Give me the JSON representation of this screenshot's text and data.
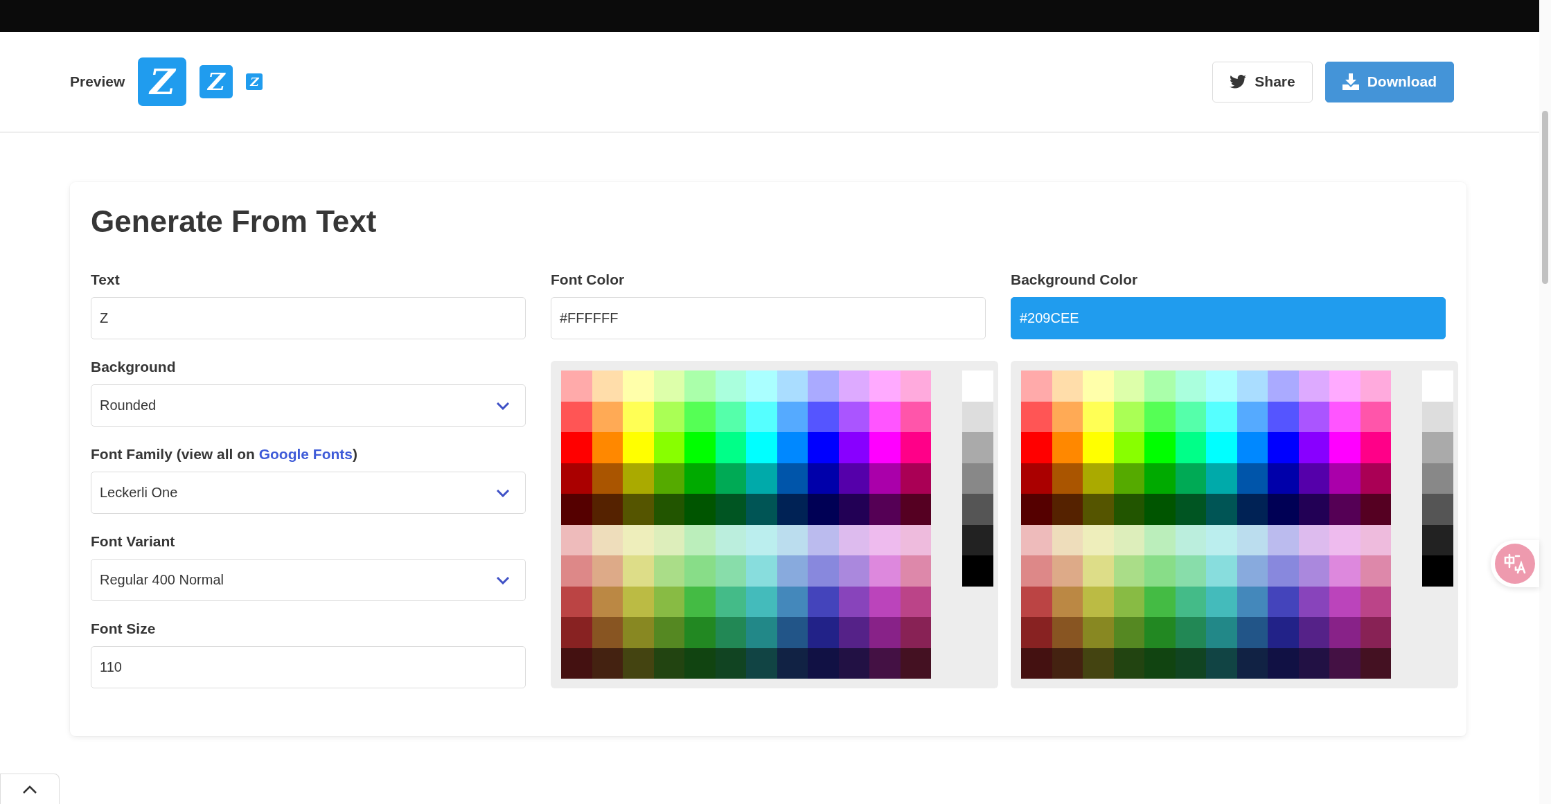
{
  "header": {
    "preview_label": "Preview",
    "preview_icons": [
      {
        "text": "Z"
      },
      {
        "text": "Z"
      },
      {
        "text": "Z"
      }
    ],
    "buttons": [
      {
        "kind": "share",
        "label": "Share"
      },
      {
        "kind": "download",
        "label": "Download"
      }
    ]
  },
  "card": {
    "title": "Generate From Text",
    "fields": [
      {
        "kind": "input",
        "label": "Text",
        "value": "Z"
      },
      {
        "kind": "select",
        "label": "Background",
        "value": "Rounded"
      },
      {
        "kind": "select",
        "label": "Font Family (view all on ",
        "link": "Google Fonts",
        "label_after": ")",
        "value": "Leckerli One"
      },
      {
        "kind": "select",
        "label": "Font Variant",
        "value": "Regular 400 Normal"
      },
      {
        "kind": "input",
        "label": "Font Size",
        "value": "110"
      }
    ],
    "color_pickers": [
      {
        "label": "Font Color",
        "value": "#FFFFFF",
        "swatch_rows": [
          [
            {
              "color": "#ffaaaa"
            },
            {
              "color": "#ffddaa"
            },
            {
              "color": "#ffffaa"
            },
            {
              "color": "#ddffaa"
            },
            {
              "color": "#aaffaa"
            },
            {
              "color": "#aaffdd"
            },
            {
              "color": "#aaffff"
            },
            {
              "color": "#aaddff"
            },
            {
              "color": "#aaaaff"
            },
            {
              "color": "#ddaaff"
            },
            {
              "color": "#ffaaff"
            },
            {
              "color": "#ffaadd"
            }
          ],
          [
            {
              "color": "#ff5555"
            },
            {
              "color": "#ffaa55"
            },
            {
              "color": "#ffff55"
            },
            {
              "color": "#aaff55"
            },
            {
              "color": "#55ff55"
            },
            {
              "color": "#55ffaa"
            },
            {
              "color": "#55ffff"
            },
            {
              "color": "#55aaff"
            },
            {
              "color": "#5555ff"
            },
            {
              "color": "#aa55ff"
            },
            {
              "color": "#ff55ff"
            },
            {
              "color": "#ff55aa"
            }
          ],
          [
            {
              "color": "#ff0000"
            },
            {
              "color": "#ff8800"
            },
            {
              "color": "#ffff00"
            },
            {
              "color": "#88ff00"
            },
            {
              "color": "#00ff00"
            },
            {
              "color": "#00ff88"
            },
            {
              "color": "#00ffff"
            },
            {
              "color": "#0088ff"
            },
            {
              "color": "#0000ff"
            },
            {
              "color": "#8800ff"
            },
            {
              "color": "#ff00ff"
            },
            {
              "color": "#ff0088"
            }
          ],
          [
            {
              "color": "#aa0000"
            },
            {
              "color": "#aa5500"
            },
            {
              "color": "#aaaa00"
            },
            {
              "color": "#55aa00"
            },
            {
              "color": "#00aa00"
            },
            {
              "color": "#00aa55"
            },
            {
              "color": "#00aaaa"
            },
            {
              "color": "#0055aa"
            },
            {
              "color": "#0000aa"
            },
            {
              "color": "#5500aa"
            },
            {
              "color": "#aa00aa"
            },
            {
              "color": "#aa0055"
            }
          ],
          [
            {
              "color": "#550000"
            },
            {
              "color": "#552200"
            },
            {
              "color": "#555500"
            },
            {
              "color": "#225500"
            },
            {
              "color": "#005500"
            },
            {
              "color": "#005522"
            },
            {
              "color": "#005555"
            },
            {
              "color": "#002255"
            },
            {
              "color": "#000055"
            },
            {
              "color": "#220055"
            },
            {
              "color": "#550055"
            },
            {
              "color": "#550022"
            }
          ],
          [
            {
              "color": "#eebbbb"
            },
            {
              "color": "#eeddbb"
            },
            {
              "color": "#eeeebb"
            },
            {
              "color": "#ddeebb"
            },
            {
              "color": "#bbeebb"
            },
            {
              "color": "#bbeedd"
            },
            {
              "color": "#bbeeee"
            },
            {
              "color": "#bbddee"
            },
            {
              "color": "#bbbbee"
            },
            {
              "color": "#ddbbee"
            },
            {
              "color": "#eebbee"
            },
            {
              "color": "#eebbdd"
            }
          ],
          [
            {
              "color": "#dd8888"
            },
            {
              "color": "#ddaa88"
            },
            {
              "color": "#dddd88"
            },
            {
              "color": "#aadd88"
            },
            {
              "color": "#88dd88"
            },
            {
              "color": "#88ddaa"
            },
            {
              "color": "#88dddd"
            },
            {
              "color": "#88aadd"
            },
            {
              "color": "#8888dd"
            },
            {
              "color": "#aa88dd"
            },
            {
              "color": "#dd88dd"
            },
            {
              "color": "#dd88aa"
            }
          ],
          [
            {
              "color": "#bb4444"
            },
            {
              "color": "#bb8844"
            },
            {
              "color": "#bbbb44"
            },
            {
              "color": "#88bb44"
            },
            {
              "color": "#44bb44"
            },
            {
              "color": "#44bb88"
            },
            {
              "color": "#44bbbb"
            },
            {
              "color": "#4488bb"
            },
            {
              "color": "#4444bb"
            },
            {
              "color": "#8844bb"
            },
            {
              "color": "#bb44bb"
            },
            {
              "color": "#bb4488"
            }
          ],
          [
            {
              "color": "#882222"
            },
            {
              "color": "#885522"
            },
            {
              "color": "#888822"
            },
            {
              "color": "#558822"
            },
            {
              "color": "#228822"
            },
            {
              "color": "#228855"
            },
            {
              "color": "#228888"
            },
            {
              "color": "#225588"
            },
            {
              "color": "#222288"
            },
            {
              "color": "#552288"
            },
            {
              "color": "#882288"
            },
            {
              "color": "#882255"
            }
          ],
          [
            {
              "color": "#441111"
            },
            {
              "color": "#442211"
            },
            {
              "color": "#444411"
            },
            {
              "color": "#224411"
            },
            {
              "color": "#114411"
            },
            {
              "color": "#114422"
            },
            {
              "color": "#114444"
            },
            {
              "color": "#112244"
            },
            {
              "color": "#111144"
            },
            {
              "color": "#221144"
            },
            {
              "color": "#441144"
            },
            {
              "color": "#441122"
            }
          ]
        ],
        "shade_swatches": [
          {
            "color": "#ffffff"
          },
          {
            "color": "#dddddd"
          },
          {
            "color": "#aaaaaa"
          },
          {
            "color": "#888888"
          },
          {
            "color": "#555555"
          },
          {
            "color": "#222222"
          },
          {
            "color": "#000000"
          }
        ]
      },
      {
        "label": "Background Color",
        "value": "#209CEE",
        "swatch_rows": [
          [
            {
              "color": "#ffaaaa"
            },
            {
              "color": "#ffddaa"
            },
            {
              "color": "#ffffaa"
            },
            {
              "color": "#ddffaa"
            },
            {
              "color": "#aaffaa"
            },
            {
              "color": "#aaffdd"
            },
            {
              "color": "#aaffff"
            },
            {
              "color": "#aaddff"
            },
            {
              "color": "#aaaaff"
            },
            {
              "color": "#ddaaff"
            },
            {
              "color": "#ffaaff"
            },
            {
              "color": "#ffaadd"
            }
          ],
          [
            {
              "color": "#ff5555"
            },
            {
              "color": "#ffaa55"
            },
            {
              "color": "#ffff55"
            },
            {
              "color": "#aaff55"
            },
            {
              "color": "#55ff55"
            },
            {
              "color": "#55ffaa"
            },
            {
              "color": "#55ffff"
            },
            {
              "color": "#55aaff"
            },
            {
              "color": "#5555ff"
            },
            {
              "color": "#aa55ff"
            },
            {
              "color": "#ff55ff"
            },
            {
              "color": "#ff55aa"
            }
          ],
          [
            {
              "color": "#ff0000"
            },
            {
              "color": "#ff8800"
            },
            {
              "color": "#ffff00"
            },
            {
              "color": "#88ff00"
            },
            {
              "color": "#00ff00"
            },
            {
              "color": "#00ff88"
            },
            {
              "color": "#00ffff"
            },
            {
              "color": "#0088ff"
            },
            {
              "color": "#0000ff"
            },
            {
              "color": "#8800ff"
            },
            {
              "color": "#ff00ff"
            },
            {
              "color": "#ff0088"
            }
          ],
          [
            {
              "color": "#aa0000"
            },
            {
              "color": "#aa5500"
            },
            {
              "color": "#aaaa00"
            },
            {
              "color": "#55aa00"
            },
            {
              "color": "#00aa00"
            },
            {
              "color": "#00aa55"
            },
            {
              "color": "#00aaaa"
            },
            {
              "color": "#0055aa"
            },
            {
              "color": "#0000aa"
            },
            {
              "color": "#5500aa"
            },
            {
              "color": "#aa00aa"
            },
            {
              "color": "#aa0055"
            }
          ],
          [
            {
              "color": "#550000"
            },
            {
              "color": "#552200"
            },
            {
              "color": "#555500"
            },
            {
              "color": "#225500"
            },
            {
              "color": "#005500"
            },
            {
              "color": "#005522"
            },
            {
              "color": "#005555"
            },
            {
              "color": "#002255"
            },
            {
              "color": "#000055"
            },
            {
              "color": "#220055"
            },
            {
              "color": "#550055"
            },
            {
              "color": "#550022"
            }
          ],
          [
            {
              "color": "#eebbbb"
            },
            {
              "color": "#eeddbb"
            },
            {
              "color": "#eeeebb"
            },
            {
              "color": "#ddeebb"
            },
            {
              "color": "#bbeebb"
            },
            {
              "color": "#bbeedd"
            },
            {
              "color": "#bbeeee"
            },
            {
              "color": "#bbddee"
            },
            {
              "color": "#bbbbee"
            },
            {
              "color": "#ddbbee"
            },
            {
              "color": "#eebbee"
            },
            {
              "color": "#eebbdd"
            }
          ],
          [
            {
              "color": "#dd8888"
            },
            {
              "color": "#ddaa88"
            },
            {
              "color": "#dddd88"
            },
            {
              "color": "#aadd88"
            },
            {
              "color": "#88dd88"
            },
            {
              "color": "#88ddaa"
            },
            {
              "color": "#88dddd"
            },
            {
              "color": "#88aadd"
            },
            {
              "color": "#8888dd"
            },
            {
              "color": "#aa88dd"
            },
            {
              "color": "#dd88dd"
            },
            {
              "color": "#dd88aa"
            }
          ],
          [
            {
              "color": "#bb4444"
            },
            {
              "color": "#bb8844"
            },
            {
              "color": "#bbbb44"
            },
            {
              "color": "#88bb44"
            },
            {
              "color": "#44bb44"
            },
            {
              "color": "#44bb88"
            },
            {
              "color": "#44bbbb"
            },
            {
              "color": "#4488bb"
            },
            {
              "color": "#4444bb"
            },
            {
              "color": "#8844bb"
            },
            {
              "color": "#bb44bb"
            },
            {
              "color": "#bb4488"
            }
          ],
          [
            {
              "color": "#882222"
            },
            {
              "color": "#885522"
            },
            {
              "color": "#888822"
            },
            {
              "color": "#558822"
            },
            {
              "color": "#228822"
            },
            {
              "color": "#228855"
            },
            {
              "color": "#228888"
            },
            {
              "color": "#225588"
            },
            {
              "color": "#222288"
            },
            {
              "color": "#552288"
            },
            {
              "color": "#882288"
            },
            {
              "color": "#882255"
            }
          ],
          [
            {
              "color": "#441111"
            },
            {
              "color": "#442211"
            },
            {
              "color": "#444411"
            },
            {
              "color": "#224411"
            },
            {
              "color": "#114411"
            },
            {
              "color": "#114422"
            },
            {
              "color": "#114444"
            },
            {
              "color": "#112244"
            },
            {
              "color": "#111144"
            },
            {
              "color": "#221144"
            },
            {
              "color": "#441144"
            },
            {
              "color": "#441122"
            }
          ]
        ],
        "shade_swatches": [
          {
            "color": "#ffffff"
          },
          {
            "color": "#dddddd"
          },
          {
            "color": "#aaaaaa"
          },
          {
            "color": "#888888"
          },
          {
            "color": "#555555"
          },
          {
            "color": "#222222"
          },
          {
            "color": "#000000"
          }
        ]
      }
    ]
  }
}
